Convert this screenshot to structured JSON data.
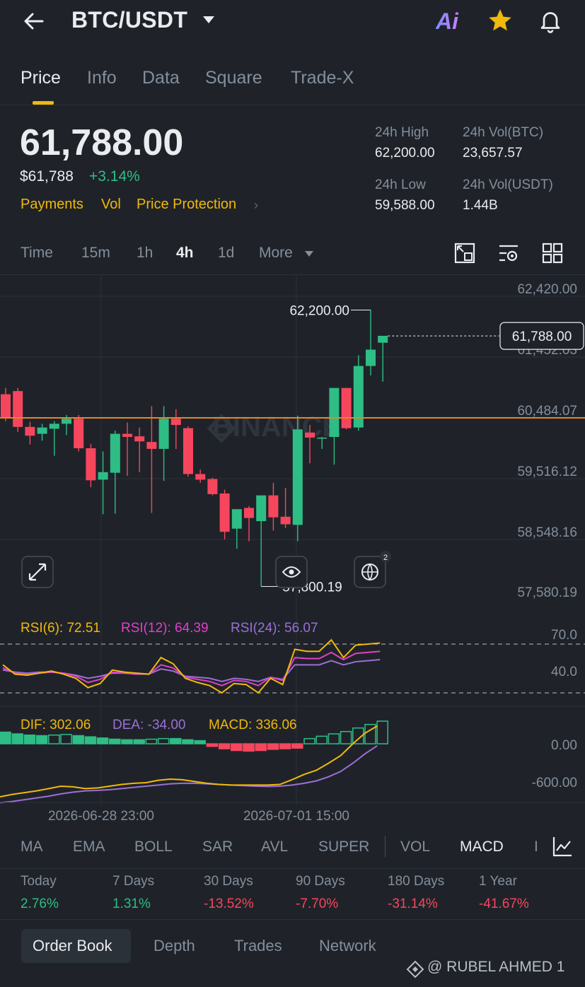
{
  "header": {
    "pair": "BTC/USDT",
    "ai_label": "Ai",
    "icons": [
      "back-arrow-icon",
      "caret-down-icon",
      "ai-icon",
      "star-icon",
      "bell-icon"
    ]
  },
  "tabs": [
    "Price",
    "Info",
    "Data",
    "Square",
    "Trade-X"
  ],
  "active_tab": "Price",
  "price": {
    "last": "61,788.00",
    "usd": "$61,788",
    "change_pct": "+3.14%",
    "links": [
      "Payments",
      "Vol",
      "Price Protection"
    ],
    "stats": {
      "high_label": "24h High",
      "high": "62,200.00",
      "low_label": "24h Low",
      "low": "59,588.00",
      "vol_btc_label": "24h Vol(BTC)",
      "vol_btc": "23,657.57",
      "vol_usdt_label": "24h Vol(USDT)",
      "vol_usdt": "1.44B"
    }
  },
  "intervals": [
    "Time",
    "15m",
    "1h",
    "4h",
    "1d",
    "More"
  ],
  "active_interval": "4h",
  "chart_data": {
    "type": "candlestick",
    "watermark": "BINANCE",
    "y_ticks": [
      "62,420.00",
      "61,452.03",
      "60,484.07",
      "59,516.12",
      "58,548.16",
      "57,580.19"
    ],
    "last_price_label": "61,788.00",
    "high_marker": "62,200.00",
    "low_marker": "57,800.19",
    "x_ticks": [
      "2026-06-28 23:00",
      "2026-07-01 15:00"
    ],
    "ylim": [
      57580.19,
      62420.0
    ],
    "candles": [
      {
        "o": 60860,
        "h": 60960,
        "l": 60430,
        "c": 60480
      },
      {
        "o": 60910,
        "h": 60960,
        "l": 60260,
        "c": 60340
      },
      {
        "o": 60340,
        "h": 60420,
        "l": 60060,
        "c": 60200
      },
      {
        "o": 60230,
        "h": 60390,
        "l": 60120,
        "c": 60330
      },
      {
        "o": 60310,
        "h": 60430,
        "l": 59880,
        "c": 60390
      },
      {
        "o": 60390,
        "h": 60530,
        "l": 60210,
        "c": 60470
      },
      {
        "o": 60470,
        "h": 60530,
        "l": 59950,
        "c": 60000
      },
      {
        "o": 60000,
        "h": 60070,
        "l": 59380,
        "c": 59490
      },
      {
        "o": 59500,
        "h": 59950,
        "l": 58950,
        "c": 59620
      },
      {
        "o": 59610,
        "h": 60280,
        "l": 58960,
        "c": 60230
      },
      {
        "o": 60230,
        "h": 60410,
        "l": 59560,
        "c": 60180
      },
      {
        "o": 60190,
        "h": 60330,
        "l": 59620,
        "c": 60110
      },
      {
        "o": 60100,
        "h": 60670,
        "l": 58970,
        "c": 59990
      },
      {
        "o": 59990,
        "h": 60670,
        "l": 59480,
        "c": 60470
      },
      {
        "o": 60470,
        "h": 60620,
        "l": 59990,
        "c": 60370
      },
      {
        "o": 60320,
        "h": 60350,
        "l": 59550,
        "c": 59590
      },
      {
        "o": 59590,
        "h": 59660,
        "l": 59450,
        "c": 59500
      },
      {
        "o": 59510,
        "h": 59530,
        "l": 59250,
        "c": 59270
      },
      {
        "o": 59280,
        "h": 59340,
        "l": 58550,
        "c": 58670
      },
      {
        "o": 58720,
        "h": 59030,
        "l": 58400,
        "c": 59030
      },
      {
        "o": 59050,
        "h": 59080,
        "l": 58520,
        "c": 58890
      },
      {
        "o": 58840,
        "h": 59200,
        "l": 57800,
        "c": 59250
      },
      {
        "o": 59250,
        "h": 59450,
        "l": 58690,
        "c": 58900
      },
      {
        "o": 58910,
        "h": 59370,
        "l": 58730,
        "c": 58790
      },
      {
        "o": 58780,
        "h": 60520,
        "l": 58520,
        "c": 60300
      },
      {
        "o": 60250,
        "h": 60370,
        "l": 59760,
        "c": 60170
      },
      {
        "o": 60160,
        "h": 60180,
        "l": 59990,
        "c": 60170
      },
      {
        "o": 60180,
        "h": 60940,
        "l": 59740,
        "c": 60960
      },
      {
        "o": 60960,
        "h": 60960,
        "l": 60300,
        "c": 60320
      },
      {
        "o": 60330,
        "h": 61480,
        "l": 60280,
        "c": 61310
      },
      {
        "o": 61310,
        "h": 62200,
        "l": 61160,
        "c": 61570
      },
      {
        "o": 61680,
        "h": 61780,
        "l": 61060,
        "c": 61790
      }
    ],
    "overlay_line_price": 60484.07
  },
  "rsi": {
    "rsi6_label": "RSI(6): 72.51",
    "rsi12_label": "RSI(12): 64.39",
    "rsi24_label": "RSI(24): 56.07",
    "ticks": [
      "70.0",
      "40.0"
    ],
    "rsi6": [
      55,
      46,
      45,
      47,
      49,
      46,
      42,
      33,
      37,
      50,
      48,
      47,
      46,
      62,
      56,
      42,
      38,
      35,
      28,
      37,
      36,
      28,
      42,
      36,
      70,
      68,
      68,
      79,
      62,
      74,
      75,
      76
    ],
    "rsi12": [
      52,
      47,
      46,
      47,
      48,
      47,
      44,
      38,
      41,
      48,
      47,
      46,
      46,
      55,
      52,
      43,
      41,
      39,
      35,
      40,
      39,
      35,
      43,
      40,
      62,
      61,
      61,
      67,
      60,
      66,
      67,
      68
    ],
    "rsi24": [
      50,
      48,
      47,
      48,
      48,
      47,
      45,
      42,
      44,
      47,
      47,
      46,
      46,
      51,
      49,
      44,
      43,
      42,
      39,
      42,
      41,
      39,
      43,
      41,
      55,
      55,
      55,
      59,
      55,
      58,
      59,
      60
    ],
    "colors": {
      "rsi6": "#f0b90b",
      "rsi12": "#e040c8",
      "rsi24": "#9b6fd6"
    }
  },
  "macd": {
    "dif_label": "DIF: 302.06",
    "dea_label": "DEA: -34.00",
    "macd_label": "MACD: 336.06",
    "ticks": [
      "0.00",
      "-600.00"
    ],
    "hist": [
      150,
      120,
      100,
      90,
      100,
      110,
      90,
      70,
      50,
      30,
      20,
      20,
      30,
      40,
      40,
      20,
      5,
      -20,
      -60,
      -90,
      -100,
      -90,
      -70,
      -60,
      -50,
      40,
      80,
      120,
      160,
      220,
      280,
      336
    ],
    "dif": [
      -900,
      -860,
      -830,
      -800,
      -760,
      -720,
      -730,
      -760,
      -750,
      -720,
      -690,
      -670,
      -660,
      -620,
      -600,
      -610,
      -640,
      -670,
      -690,
      -700,
      -700,
      -700,
      -700,
      -690,
      -610,
      -520,
      -450,
      -330,
      -200,
      0,
      180,
      302
    ],
    "dea": [
      -1000,
      -980,
      -950,
      -920,
      -890,
      -850,
      -820,
      -800,
      -790,
      -780,
      -760,
      -740,
      -720,
      -700,
      -680,
      -670,
      -670,
      -680,
      -690,
      -700,
      -710,
      -720,
      -725,
      -720,
      -700,
      -670,
      -630,
      -560,
      -470,
      -330,
      -170,
      -34
    ],
    "colors": {
      "dif": "#f0b90b",
      "dea": "#9b6fd6"
    }
  },
  "indicator_tabs": [
    "MA",
    "EMA",
    "BOLL",
    "SAR",
    "AVL",
    "SUPER",
    "VOL",
    "MACD",
    "I"
  ],
  "active_indicator": "MACD",
  "performance": [
    {
      "label": "Today",
      "value": "2.76%",
      "trend": "up"
    },
    {
      "label": "7 Days",
      "value": "1.31%",
      "trend": "up"
    },
    {
      "label": "30 Days",
      "value": "-13.52%",
      "trend": "down"
    },
    {
      "label": "90 Days",
      "value": "-7.70%",
      "trend": "down"
    },
    {
      "label": "180 Days",
      "value": "-31.14%",
      "trend": "down"
    },
    {
      "label": "1 Year",
      "value": "-41.67%",
      "trend": "down"
    }
  ],
  "bottom_tabs": [
    "Order Book",
    "Depth",
    "Trades",
    "Network"
  ],
  "active_bottom_tab": "Order Book",
  "watermark_text": "@ RUBEL AHMED 1",
  "badge_count": "2",
  "colors": {
    "up": "#2ebd85",
    "down": "#f6465d",
    "accent": "#f0b90b",
    "bg": "#1f2329"
  }
}
